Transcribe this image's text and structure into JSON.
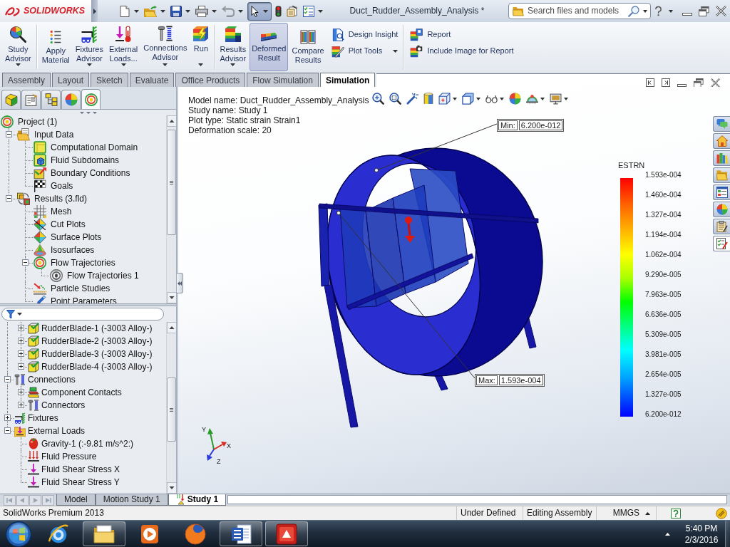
{
  "window": {
    "app_name": "SOLIDWORKS",
    "title": "Duct_Rudder_Assembly_Analysis *",
    "search": {
      "placeholder": "Search files and models"
    }
  },
  "quick_access": [
    {
      "dropdown": true,
      "disabled": false,
      "pressed": false
    },
    {
      "dropdown": true,
      "disabled": false,
      "pressed": false
    },
    {
      "dropdown": true,
      "disabled": false,
      "pressed": false
    },
    {
      "dropdown": true,
      "disabled": false,
      "pressed": false
    },
    {
      "dropdown": true,
      "disabled": true,
      "pressed": false
    },
    {
      "dropdown": true,
      "disabled": false,
      "pressed": true
    },
    {
      "dropdown": false,
      "disabled": false,
      "pressed": false
    },
    {
      "dropdown": false,
      "disabled": false,
      "pressed": false
    },
    {
      "dropdown": true,
      "disabled": false,
      "pressed": false
    }
  ],
  "ribbon": {
    "groups": [
      {
        "commands": [
          {
            "kind": "large",
            "label": "Study Advisor",
            "dropdown": true,
            "pressed": false
          }
        ]
      },
      {
        "commands": [
          {
            "kind": "large",
            "label": "Apply Material",
            "dropdown": false,
            "pressed": false
          },
          {
            "kind": "large",
            "label": "Fixtures Advisor",
            "dropdown": true,
            "pressed": false
          },
          {
            "kind": "large",
            "label": "External Loads...",
            "dropdown": true,
            "pressed": false
          },
          {
            "kind": "large",
            "label": "Connections Advisor",
            "dropdown": true,
            "pressed": false
          },
          {
            "kind": "large",
            "label": "Run",
            "dropdown": true,
            "pressed": false
          }
        ]
      },
      {
        "commands": [
          {
            "kind": "large",
            "label": "Results Advisor",
            "dropdown": true,
            "pressed": false
          },
          {
            "kind": "large",
            "label": "Deformed Result",
            "dropdown": false,
            "pressed": true
          },
          {
            "kind": "large",
            "label": "Compare Results",
            "dropdown": false,
            "pressed": false
          },
          {
            "kind": "small",
            "label": "Design Insight",
            "dropdown": false,
            "pressed": false
          },
          {
            "kind": "small",
            "label": "Plot Tools",
            "dropdown": true,
            "pressed": false
          }
        ]
      },
      {
        "commands": [
          {
            "kind": "small",
            "label": "Report",
            "dropdown": false,
            "pressed": false
          },
          {
            "kind": "small",
            "label": "Include Image for Report",
            "dropdown": false,
            "pressed": false
          }
        ]
      }
    ]
  },
  "tabs": [
    {
      "label": "Assembly",
      "selected": false
    },
    {
      "label": "Layout",
      "selected": false
    },
    {
      "label": "Sketch",
      "selected": false
    },
    {
      "label": "Evaluate",
      "selected": false
    },
    {
      "label": "Office Products",
      "selected": false
    },
    {
      "label": "Flow Simulation",
      "selected": false
    },
    {
      "label": "Simulation",
      "selected": true
    }
  ],
  "left_panel": {
    "tabs": [
      {
        "selected": false
      },
      {
        "selected": false
      },
      {
        "selected": false
      },
      {
        "selected": false
      },
      {
        "selected": true
      }
    ],
    "flow_tree": [
      {
        "label": "Project (1)",
        "children": [
          {
            "label": "Input Data",
            "expanded": true,
            "children": [
              {
                "label": "Computational Domain"
              },
              {
                "label": "Fluid Subdomains"
              },
              {
                "label": "Boundary Conditions"
              },
              {
                "label": "Goals"
              }
            ]
          },
          {
            "label": "Results (3.fld)",
            "expanded": true,
            "children": [
              {
                "label": "Mesh"
              },
              {
                "label": "Cut Plots"
              },
              {
                "label": "Surface Plots"
              },
              {
                "label": "Isosurfaces"
              },
              {
                "label": "Flow Trajectories",
                "expanded": true,
                "children": [
                  {
                    "label": "Flow Trajectories 1"
                  }
                ]
              },
              {
                "label": "Particle Studies"
              },
              {
                "label": "Point Parameters"
              }
            ]
          }
        ]
      }
    ],
    "study_tree": [
      {
        "children": [
          {
            "label": "RudderBlade-1 (-3003 Alloy-)",
            "expanded": false
          },
          {
            "label": "RudderBlade-2 (-3003 Alloy-)",
            "expanded": false
          },
          {
            "label": "RudderBlade-3 (-3003 Alloy-)",
            "expanded": false
          },
          {
            "label": "RudderBlade-4 (-3003 Alloy-)",
            "expanded": false
          }
        ]
      },
      {
        "label": "Connections",
        "expanded": true,
        "children": [
          {
            "label": "Component Contacts",
            "expanded": false
          },
          {
            "label": "Connectors",
            "expanded": false
          }
        ]
      },
      {
        "label": "Fixtures",
        "expanded": false
      },
      {
        "label": "External Loads",
        "expanded": true,
        "children": [
          {
            "label": "Gravity-1 (:-9.81 m/s^2:)"
          },
          {
            "label": "Fluid Pressure"
          },
          {
            "label": "Fluid Shear Stress X"
          },
          {
            "label": "Fluid Shear Stress Y"
          }
        ]
      }
    ]
  },
  "viewport": {
    "info": [
      "Model name: Duct_Rudder_Assembly_Analysis",
      "Study name: Study 1",
      "Plot type: Static strain Strain1",
      "Deformation scale: 20"
    ],
    "view_toolbar": [
      {
        "dropdown": false
      },
      {
        "dropdown": false
      },
      {
        "dropdown": false
      },
      {
        "dropdown": false
      },
      {
        "dropdown": true
      },
      {
        "dropdown": true
      },
      {
        "dropdown": true
      },
      {
        "dropdown": false
      },
      {
        "dropdown": true
      },
      {
        "dropdown": true
      }
    ],
    "callouts": [
      {
        "label": "Min:",
        "value": "6.200e-012"
      },
      {
        "label": "Max:",
        "value": "1.593e-004"
      }
    ],
    "legend": {
      "title": "ESTRN",
      "labels": [
        "1.593e-004",
        "1.460e-004",
        "1.327e-004",
        "1.194e-004",
        "1.062e-004",
        "9.290e-005",
        "7.963e-005",
        "6.636e-005",
        "5.309e-005",
        "3.981e-005",
        "2.654e-005",
        "1.327e-005",
        "6.200e-012"
      ]
    },
    "triad": {
      "x": "X",
      "y": "Y",
      "z": "Z"
    },
    "task_pane": [
      {
        "selected": false
      },
      {
        "selected": false
      },
      {
        "selected": false
      },
      {
        "selected": false
      },
      {
        "selected": false
      },
      {
        "selected": false
      },
      {
        "selected": false
      },
      {
        "selected": true
      }
    ]
  },
  "bottom_tabs": [
    {
      "label": "Model",
      "selected": false
    },
    {
      "label": "Motion Study 1",
      "selected": false
    },
    {
      "label": "Study 1",
      "selected": true
    }
  ],
  "status_bar": {
    "product": "SolidWorks Premium 2013",
    "state": "Under Defined",
    "mode": "Editing Assembly",
    "units": "MMGS"
  },
  "taskbar": {
    "apps": [
      {
        "running": false
      },
      {
        "running": true
      },
      {
        "running": false
      },
      {
        "running": false
      },
      {
        "running": true
      },
      {
        "running": true
      }
    ],
    "time": "5:40 PM",
    "date": "2/3/2016"
  }
}
